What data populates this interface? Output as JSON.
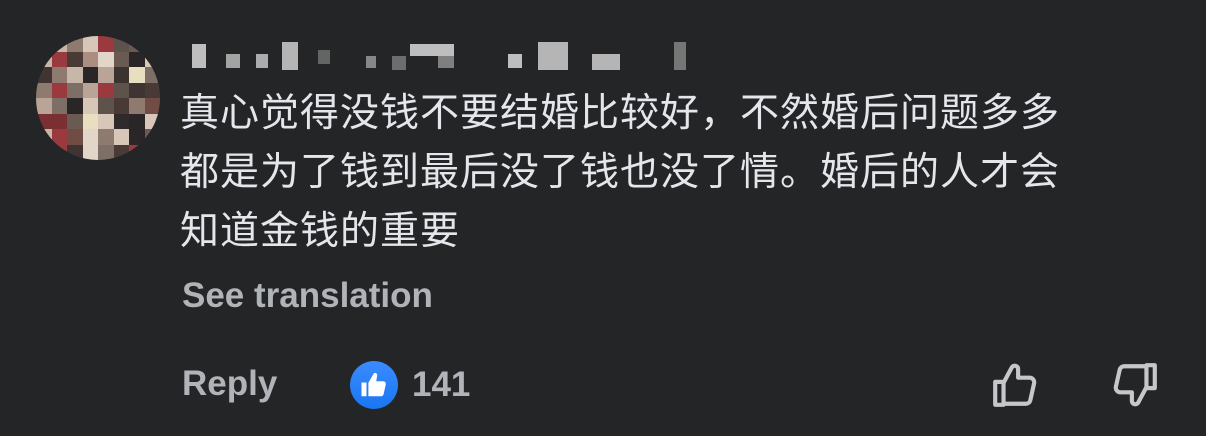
{
  "comment": {
    "lines": [
      "真心觉得没钱不要结婚比较好，不然婚后问题多多",
      "都是为了钱到最后没了钱也没了情。婚后的人才会",
      "知道金钱的重要"
    ],
    "see_translation_label": "See translation"
  },
  "actions": {
    "reply_label": "Reply",
    "like_count": "141"
  },
  "icons": {
    "reaction": "like-reaction-icon",
    "upvote": "thumbs-up-outline-icon",
    "downvote": "thumbs-down-outline-icon"
  },
  "colors": {
    "background": "#242526",
    "text_primary": "#e4e6eb",
    "text_secondary": "#b0b3b8",
    "like_blue": "#1877f2"
  }
}
